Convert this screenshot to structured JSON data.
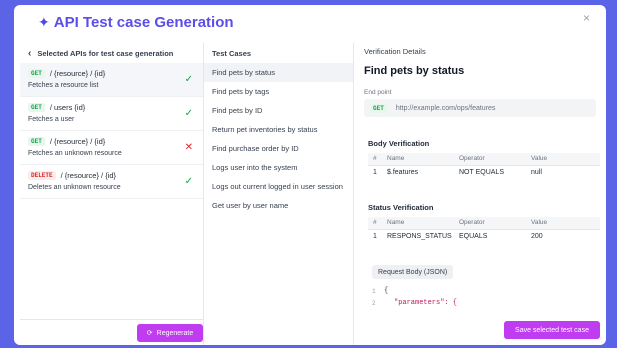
{
  "header": {
    "title": "API Test case Generation",
    "close": "×"
  },
  "apis": {
    "heading": "Selected APIs for test case generation",
    "back": "‹",
    "items": [
      {
        "method": "GET",
        "path": "/ {resource} / {id}",
        "desc": "Fetches a resource list",
        "status": "✓"
      },
      {
        "method": "GET",
        "path": "/ users {id}",
        "desc": "Fetches a user",
        "status": "✓"
      },
      {
        "method": "GET",
        "path": "/ {resource} / {id}",
        "desc": "Fetches an unknown resource",
        "status": "✕"
      },
      {
        "method": "DELETE",
        "path": "/ {resource} / {id}",
        "desc": "Deletes an unknown resource",
        "status": "✓"
      }
    ],
    "regenerate_label": "Regenerate",
    "regenerate_icon": "⟳"
  },
  "test_cases": {
    "heading": "Test Cases",
    "items": [
      "Find pets by status",
      "Find pets by tags",
      "Find pets by ID",
      "Return pet inventories by status",
      "Find purchase order by ID",
      "Logs user into the system",
      "Logs out current logged in user session",
      "Get user by user name"
    ]
  },
  "verification": {
    "heading": "Verification Details",
    "title": "Find pets by status",
    "endpoint_label": "End point",
    "endpoint_method": "GET",
    "endpoint_url": "http://example.com/ops/features",
    "body": {
      "title": "Body Verification",
      "columns": [
        "#",
        "Name",
        "Operator",
        "Value"
      ],
      "rows": [
        [
          "1",
          "$.features",
          "NOT EQUALS",
          "null"
        ]
      ]
    },
    "status": {
      "title": "Status Verification",
      "columns": [
        "#",
        "Name",
        "Operator",
        "Value"
      ],
      "rows": [
        [
          "1",
          "RESPONS_STATUS",
          "EQUALS",
          "200"
        ]
      ]
    },
    "request_body_label": "Request Body (JSON)",
    "code_lines": [
      {
        "n": "1",
        "text": "{"
      },
      {
        "n": "2",
        "text": "\"parameters\": {"
      }
    ],
    "save_label": "Save selected test case"
  }
}
